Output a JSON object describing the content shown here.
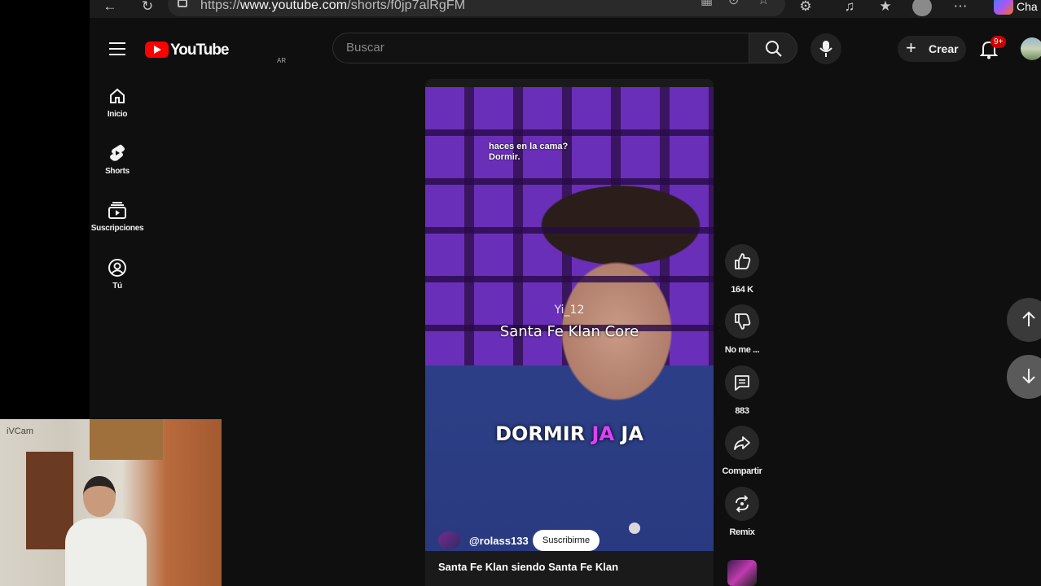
{
  "browser": {
    "url_prefix": "https://",
    "url_main": "www.youtube.com",
    "url_path": "/shorts/f0jp7alRgFM",
    "partial_tab_text": "Cha"
  },
  "header": {
    "logo_text": "YouTube",
    "country_code": "AR",
    "search_placeholder": "Buscar",
    "create_label": "Crear",
    "notification_count": "9+"
  },
  "sidebar": {
    "items": [
      {
        "label": "Inicio",
        "icon": "home-icon"
      },
      {
        "label": "Shorts",
        "icon": "shorts-icon"
      },
      {
        "label": "Suscripciones",
        "icon": "subscriptions-icon"
      },
      {
        "label": "Tú",
        "icon": "you-icon"
      }
    ]
  },
  "short": {
    "caption_line1": "haces en la cama?",
    "caption_line2": "Dormir.",
    "overlay_name": "Yi_12",
    "overlay_title": "Santa Fe Klan Core",
    "subtitle_a": "DORMIR ",
    "subtitle_b": "JA",
    "subtitle_c": " JA",
    "channel_handle": "@rolass133",
    "subscribe_label": "Suscribirme",
    "title": "Santa Fe Klan siendo Santa Fe Klan",
    "highlight_color": "#e040fb"
  },
  "actions": {
    "like_count": "164 K",
    "dislike_label": "No me ...",
    "comments_count": "883",
    "share_label": "Compartir",
    "remix_label": "Remix"
  },
  "webcam": {
    "label": "iVCam"
  }
}
